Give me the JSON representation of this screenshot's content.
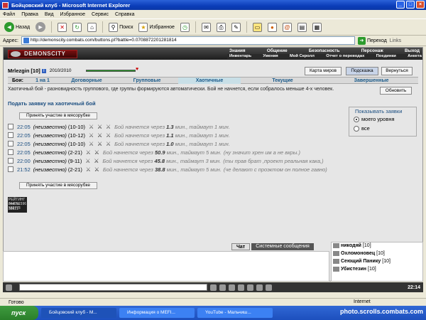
{
  "window": {
    "title": "Бойцовский клуб - Microsoft Internet Explorer"
  },
  "menu": [
    "Файл",
    "Правка",
    "Вид",
    "Избранное",
    "Сервис",
    "Справка"
  ],
  "toolbar": {
    "back": "Назад",
    "search": "Поиск",
    "favorites": "Избранное"
  },
  "address": {
    "label": "Адрес:",
    "url": "http://demonscity.combats.com/buttons.pl?battle=0.0708872201281814",
    "go": "Переход",
    "links": "Links"
  },
  "game": {
    "logo": "DEMONSCITY",
    "nav": [
      "Знания",
      "Общение",
      "Безопасность",
      "Персонаж",
      "Выход"
    ],
    "subnav": [
      "Инвентарь",
      "Умения",
      "Мой Скролл",
      "Отчет о переводах",
      "Поединки",
      "Анкета"
    ],
    "player": {
      "name": "Mrlezgin",
      "level": "[10]",
      "date": "2010/2010"
    },
    "buttons": {
      "map": "Карта миров",
      "hint": "Подсказка",
      "back": "Вернуться"
    },
    "tabs": [
      "Бои:",
      "1 на 1",
      "Договорные",
      "Групповые",
      "Хаотичные",
      "Текущие",
      "Завершенные"
    ],
    "description": "Хаотичный бой - разновидность группового, где группы формируются автоматически. Бой не начнется, если собралось меньше 4-х человек.",
    "refresh": "Обновить",
    "submit_title": "Подать заявку на хаотичный бой",
    "join_top": "Принять участие в мясорубке",
    "join_bottom": "Принять участие в мясорубке",
    "view": {
      "title": "Показывать заявки",
      "opt1": "моего уровня",
      "opt2": "все"
    },
    "rows": [
      {
        "time": "22:05",
        "who": "(неизвестно)",
        "lv": "(10-10)",
        "pre": "Бой начнется через",
        "val": "1.3",
        "post": "мин., таймаут 1 мин.",
        "comment": ""
      },
      {
        "time": "22:05",
        "who": "(неизвестно)",
        "lv": "(10-12)",
        "pre": "Бой начнется через",
        "val": "1.1",
        "post": "мин., таймаут 1 мин.",
        "comment": ""
      },
      {
        "time": "22:05",
        "who": "(неизвестно)",
        "lv": "(10-10)",
        "pre": "Бой начнется через",
        "val": "1.0",
        "post": "мин., таймаут 1 мин.",
        "comment": ""
      },
      {
        "time": "22:05",
        "who": "(неизвестно)",
        "lv": "(2-21)",
        "pre": "Бой начнется через",
        "val": "50.9",
        "post": "мин., таймаут 5 мин.",
        "comment": "(ну значит хрен им а не вкры.)"
      },
      {
        "time": "22:00",
        "who": "(неизвестно)",
        "lv": "(9-11)",
        "pre": "Бой начнется через",
        "val": "45.8",
        "post": "мин., таймаут 3 мин.",
        "comment": "(ты прав брат ,проект реальная кака,)"
      },
      {
        "time": "21:52",
        "who": "(неизвестно)",
        "lv": "(2-21)",
        "pre": "Бой начнется через",
        "val": "38.8",
        "post": "мин., таймаут 5 мин.",
        "comment": "(че делают с проэктом он полное гавно)"
      }
    ],
    "counter": [
      "РЕЙТИНГ 344791596",
      "mail.ru 532778",
      "38921"
    ]
  },
  "chat": {
    "tabs": [
      "Чат",
      "Системные сообщения"
    ],
    "users": [
      {
        "name": "никодяй",
        "lvl": "[10]"
      },
      {
        "name": "Охломоновец",
        "lvl": "[10]"
      },
      {
        "name": "Сеющий Панику",
        "lvl": "[10]"
      },
      {
        "name": "Убистезин",
        "lvl": "[10]"
      }
    ],
    "clock": "22:14"
  },
  "status": {
    "left": "Готово",
    "zone": "Internet"
  },
  "taskbar": {
    "start": "пуск",
    "tasks": [
      "Бойцовский клуб - М...",
      "Информация о MEFI...",
      "YouTube - Мальчиш..."
    ],
    "watermark": "photo.scrolls.combats.com"
  }
}
